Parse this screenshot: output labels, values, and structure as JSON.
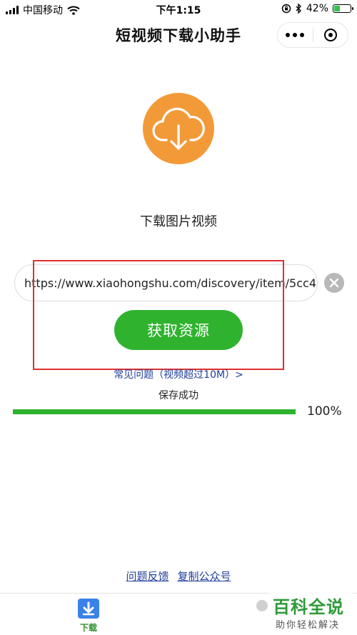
{
  "status_bar": {
    "carrier": "中国移动",
    "time": "下午1:15",
    "battery_percent": "42%",
    "battery_level": 0.42,
    "icons": [
      "signal-icon",
      "wifi-icon",
      "orientation-lock-icon",
      "bluetooth-icon",
      "battery-icon"
    ]
  },
  "nav": {
    "title": "短视频下载小助手",
    "more_icon": "more-dots-icon",
    "close_icon": "target-circle-icon"
  },
  "main": {
    "logo_icon": "cloud-download-icon",
    "logo_color": "#f39a38",
    "subtitle": "下载图片视频",
    "url_value": "https://www.xiaohongshu.com/discovery/item/5cc4",
    "clear_icon": "clear-x-icon",
    "fetch_button": "获取资源",
    "accent_color": "#2fb32f",
    "faq_link": "常见问题（视频超过10M）>",
    "save_status": "保存成功",
    "progress": {
      "value": 1.0,
      "label": "100%"
    }
  },
  "footer": {
    "feedback_link": "问题反馈",
    "copy_account_link": "复制公众号"
  },
  "tabbar": {
    "download_label": "下载",
    "download_icon": "download-box-icon"
  },
  "watermark": {
    "main": "百科全说",
    "sub": "助你轻松解决"
  }
}
